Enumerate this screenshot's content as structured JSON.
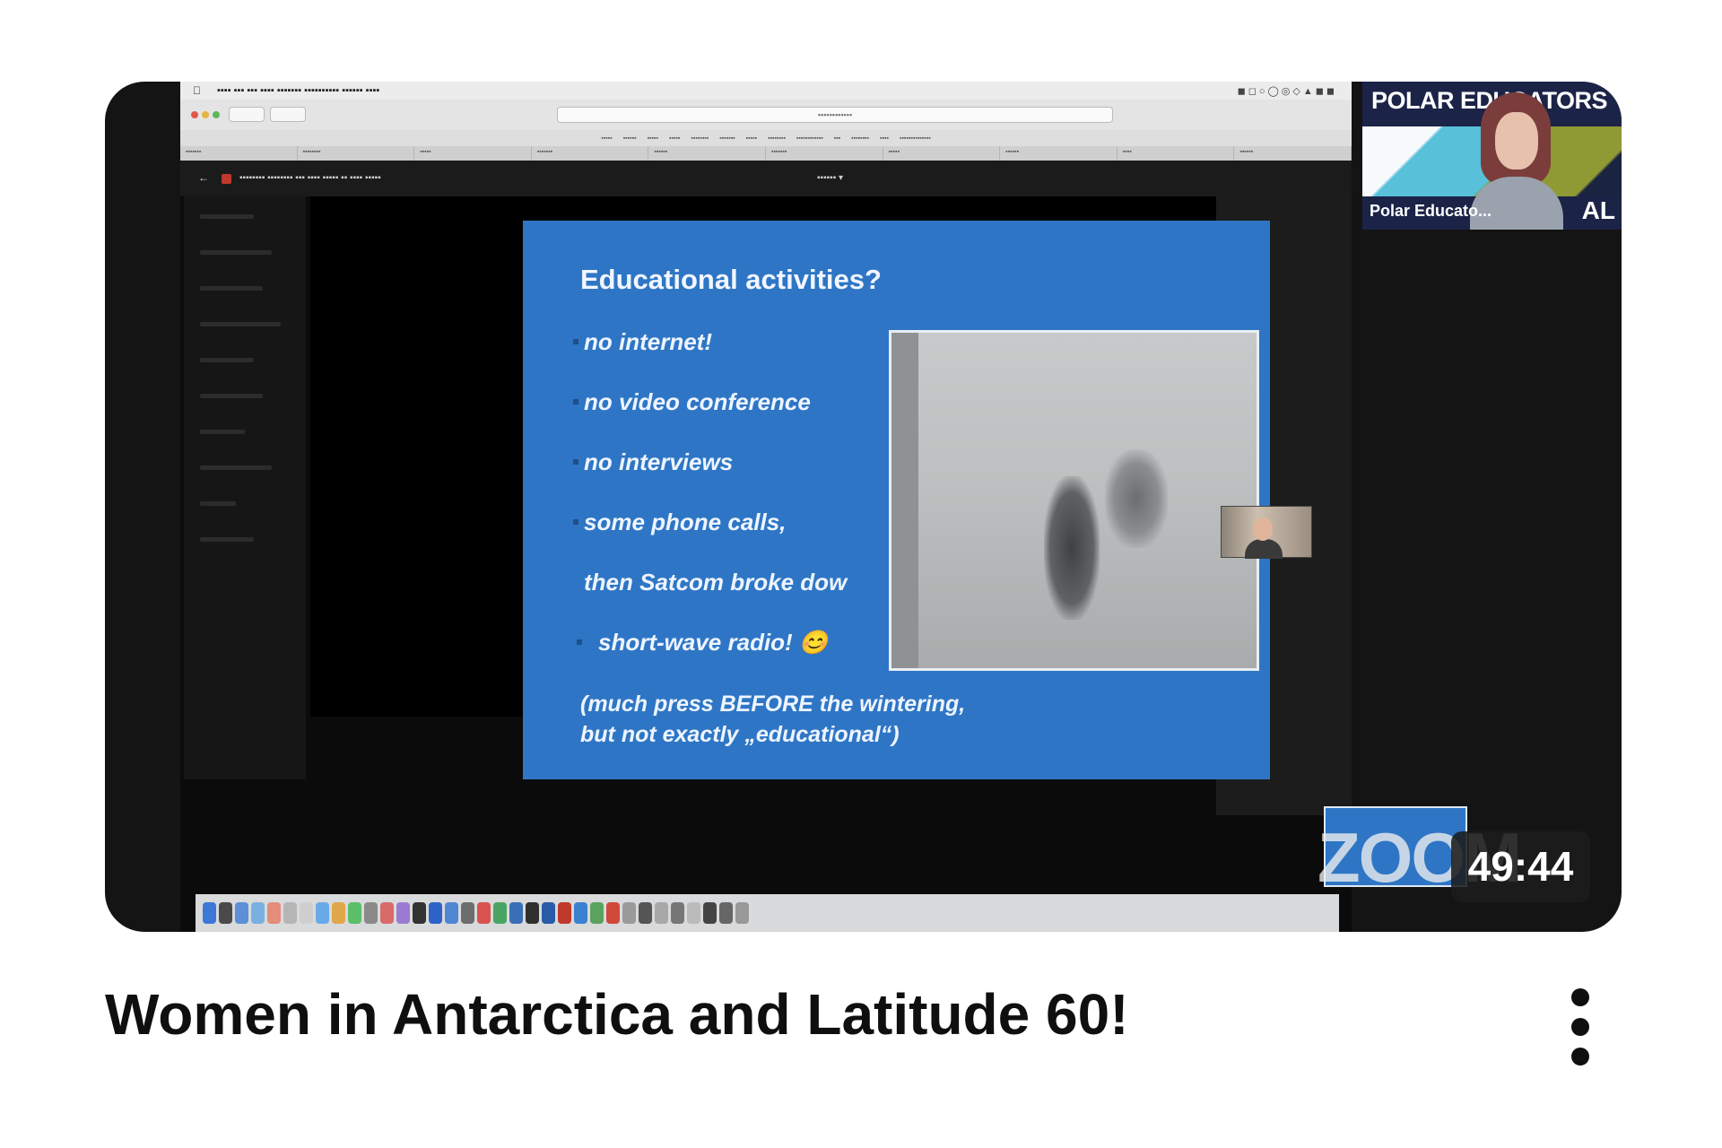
{
  "video": {
    "title": "Women in Antarctica and Latitude 60!",
    "duration": "49:44"
  },
  "slide": {
    "heading": "Educational activities?",
    "bullets": [
      "no internet!",
      "no video conference",
      "no interviews",
      "some phone calls,",
      "then Satcom broke dow",
      "short-wave radio! 😊"
    ],
    "note_line1": "(much press BEFORE the wintering,",
    "note_line2": "but not exactly „educational“)"
  },
  "webcam": {
    "brand_text": "POLAR EDUCATORS",
    "participant_name": "Polar Educato...",
    "brand_tail": "AL"
  },
  "watermark": "ZOOM",
  "icons": {
    "more": "more-vert-icon",
    "back": "back-arrow-icon",
    "recording": "recording-icon"
  },
  "colors": {
    "slide_bg": "#2e76c5",
    "duration_badge": "#1c1c1c",
    "title_text": "#0f0f0f"
  }
}
